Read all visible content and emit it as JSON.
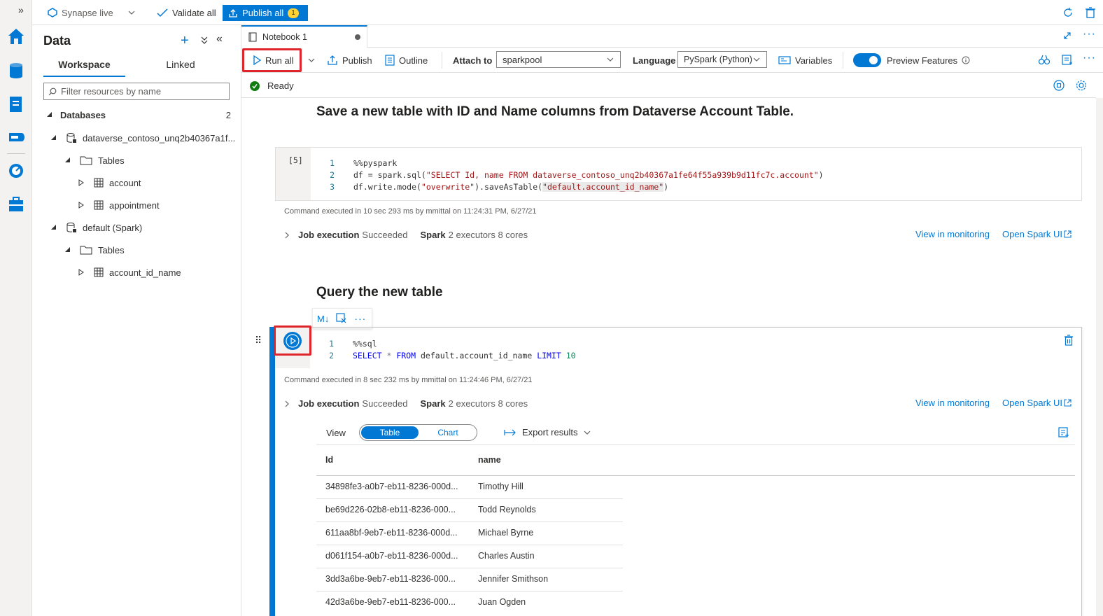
{
  "topbar": {
    "workspace": "Synapse live",
    "validate_all": "Validate all",
    "publish_all": "Publish all",
    "publish_count": "1"
  },
  "data_panel": {
    "title": "Data",
    "tabs": [
      "Workspace",
      "Linked"
    ],
    "filter_placeholder": "Filter resources by name",
    "databases_label": "Databases",
    "databases_count": "2",
    "db1": "dataverse_contoso_unq2b40367a1f...",
    "tables_label": "Tables",
    "db1_tables": [
      "account",
      "appointment"
    ],
    "db2": "default (Spark)",
    "db2_tables": [
      "account_id_name"
    ]
  },
  "notebook": {
    "tab": "Notebook 1",
    "toolbar": {
      "run_all": "Run all",
      "publish": "Publish",
      "outline": "Outline",
      "attach_to": "Attach to",
      "pool": "sparkpool",
      "language_label": "Language",
      "language": "PySpark (Python)",
      "variables": "Variables",
      "preview": "Preview Features"
    },
    "status": "Ready",
    "md1": "Save a new table with ID and Name columns from Dataverse Account Table.",
    "cell1": {
      "exec_count": "[5]",
      "lines": [
        "1",
        "2",
        "3"
      ],
      "code1": "%%pyspark",
      "code2a": "df = spark.sql(",
      "code2b": "\"SELECT Id, name FROM dataverse_contoso_unq2b40367a1fe64f55a939b9d11fc7c.account\"",
      "code2c": ")",
      "code3a": "df.write.mode(",
      "code3b": "\"overwrite\"",
      "code3c": ").saveAsTable(",
      "code3d": "\"default.account_id_name\"",
      "code3e": ")",
      "exec_info": "Command executed in 10 sec 293 ms by mmittal on 11:24:31 PM, 6/27/21"
    },
    "job": {
      "label": "Job execution",
      "state": "Succeeded",
      "spark": "Spark",
      "spark_info": "2 executors 8 cores",
      "view_monitoring": "View in monitoring",
      "open_spark_ui": "Open Spark UI"
    },
    "md2": "Query the new table",
    "cell_toolbar": {
      "md": "M↓"
    },
    "cell2": {
      "lines": [
        "1",
        "2"
      ],
      "code1": "%%sql",
      "kw_select": "SELECT",
      "star": "*",
      "kw_from": "FROM",
      "table": "default.account_id_name",
      "kw_limit": "LIMIT",
      "limit_val": "10",
      "exec_info": "Command executed in 8 sec 232 ms by mmittal on 11:24:46 PM, 6/27/21"
    },
    "results": {
      "view_label": "View",
      "table_toggle": "Table",
      "chart_toggle": "Chart",
      "export": "Export results",
      "columns": [
        "Id",
        "name"
      ],
      "rows": [
        [
          "34898fe3-a0b7-eb11-8236-000d...",
          "Timothy Hill"
        ],
        [
          "be69d226-02b8-eb11-8236-000...",
          "Todd Reynolds"
        ],
        [
          "611aa8bf-9eb7-eb11-8236-000d...",
          "Michael Byrne"
        ],
        [
          "d061f154-a0b7-eb11-8236-000d...",
          "Charles Austin"
        ],
        [
          "3dd3a6be-9eb7-eb11-8236-000...",
          "Jennifer Smithson"
        ],
        [
          "42d3a6be-9eb7-eb11-8236-000...",
          "Juan Ogden"
        ]
      ]
    }
  }
}
